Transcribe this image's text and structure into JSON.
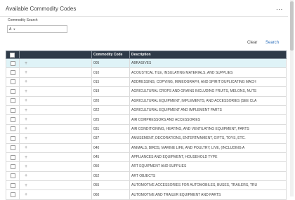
{
  "panel": {
    "title": "Available Commodity Codes",
    "menu_glyph": "..."
  },
  "search": {
    "label": "Commodity Search",
    "mode": "A",
    "value": "",
    "placeholder": ""
  },
  "actions": {
    "clear": "Clear",
    "search": "Search"
  },
  "table": {
    "headers": {
      "code": "Commodity Code",
      "description": "Description"
    },
    "rows": [
      {
        "code": "005",
        "description": "ABRASIVES",
        "selected": true
      },
      {
        "code": "010",
        "description": "ACOUSTICAL TILE, INSULATING MATERIALS, AND SUPPLIES"
      },
      {
        "code": "015",
        "description": "ADDRESSING, COPYING, MIMEOGRAPH, AND SPIRIT DUPLICATING MACH"
      },
      {
        "code": "019",
        "description": "AGRICULTURAL CROPS AND GRAINS INCLUDING FRUITS, MELONS, NUTS"
      },
      {
        "code": "020",
        "description": "AGRICULTURAL EQUIPMENT, IMPLEMENTS, AND ACCESSORIES (SEE CLA"
      },
      {
        "code": "022",
        "description": "AGRICULTURAL EQUIPMENT AND IMPLEMENT PARTS"
      },
      {
        "code": "025",
        "description": "AIR COMPRESSORS AND ACCESSORIES"
      },
      {
        "code": "031",
        "description": "AIR CONDITIONING, HEATING, AND VENTILATING EQUIPMENT, PARTS"
      },
      {
        "code": "037",
        "description": "AMUSEMENT, DECORATIONS, ENTERTAINMENT, GIFTS, TOYS, ETC."
      },
      {
        "code": "040",
        "description": "ANIMALS, BIRDS, MARINE LIFE, AND POULTRY, LIVE, (INCLUDING A"
      },
      {
        "code": "045",
        "description": "APPLIANCES AND EQUIPMENT, HOUSEHOLD TYPE"
      },
      {
        "code": "050",
        "description": "ART EQUIPMENT AND SUPPLIES"
      },
      {
        "code": "052",
        "description": "ART OBJECTS"
      },
      {
        "code": "055",
        "description": "AUTOMOTIVE ACCESSORIES FOR AUTOMOBILES, BUSES, TRAILERS, TRU"
      },
      {
        "code": "060",
        "description": "AUTOMOTIVE AND TRAILER EQUIPMENT AND PARTS"
      }
    ]
  }
}
